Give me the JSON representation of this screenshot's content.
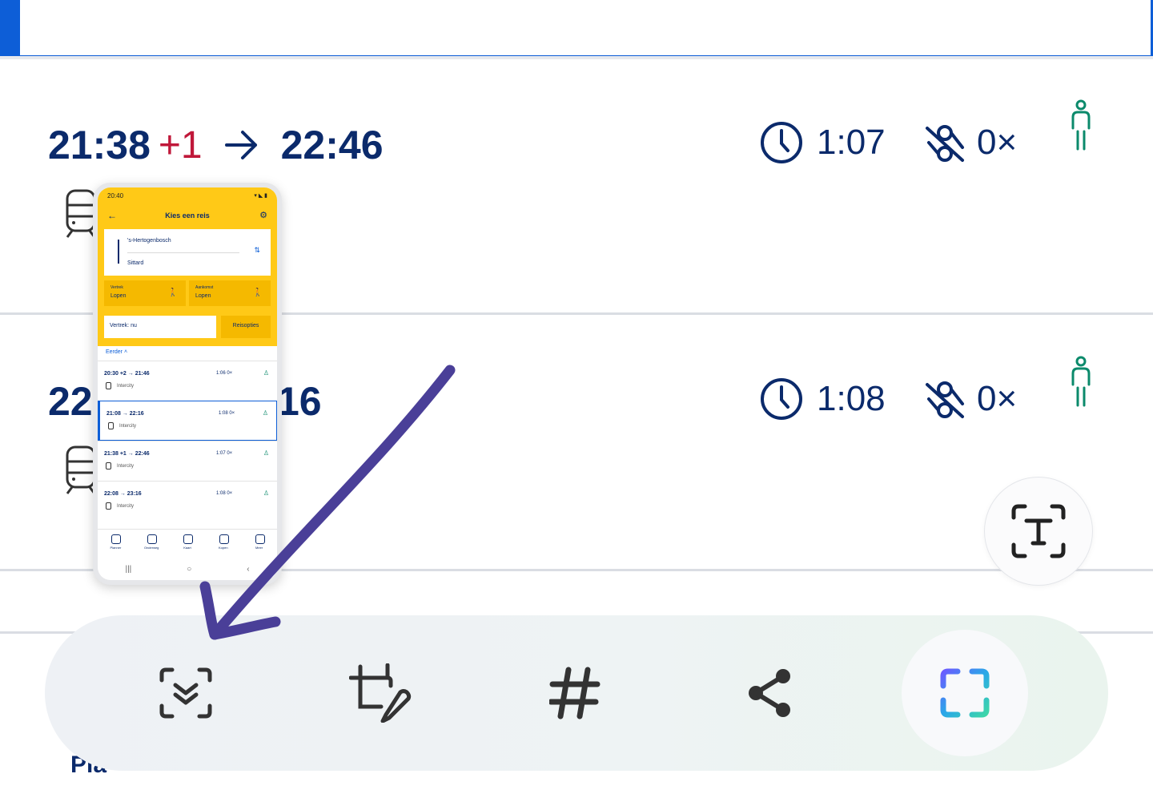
{
  "journeys": [
    {
      "depart": "21:38",
      "plus": "+1",
      "arrive": "22:46",
      "duration": "1:07",
      "transfers": "0×"
    },
    {
      "depart": "22",
      "plus": "",
      "arrive": "16",
      "duration": "1:08",
      "transfers": "0×"
    }
  ],
  "peek_text": "Pla",
  "toolbar": {
    "items": [
      "smart-select-icon",
      "crop-edit-icon",
      "hashtag-icon",
      "share-icon",
      "expand-capture-icon"
    ]
  },
  "thumbnail": {
    "status_time": "20:40",
    "title": "Kies een reis",
    "from": "'s-Hertogenbosch",
    "to": "Sittard",
    "vertrek_label": "Vertrek",
    "vertrek_value": "Lopen",
    "aankomst_label": "Aankomst",
    "aankomst_value": "Lopen",
    "depart_field": "Vertrek: nu",
    "options_button": "Reisopties",
    "earlier": "Eerder",
    "rows": [
      {
        "time": "20:30 +2 → 21:46",
        "meta": "1:06  0×",
        "kind": "Intercity"
      },
      {
        "time": "21:08 → 22:16",
        "meta": "1:08  0×",
        "kind": "Intercity"
      },
      {
        "time": "21:38 +1 → 22:46",
        "meta": "1:07  0×",
        "kind": "Intercity"
      },
      {
        "time": "22:08 → 23:16",
        "meta": "1:08  0×",
        "kind": "Intercity"
      }
    ],
    "nav": [
      "Planner",
      "Onderweg",
      "Kaart",
      "Kopen",
      "Meer"
    ]
  },
  "colors": {
    "brand_blue": "#0b2a6b",
    "accent_blue": "#0d5ed7",
    "delay_red": "#c0183a",
    "ns_yellow": "#ffc917",
    "annotation_purple": "#4a3f98"
  }
}
